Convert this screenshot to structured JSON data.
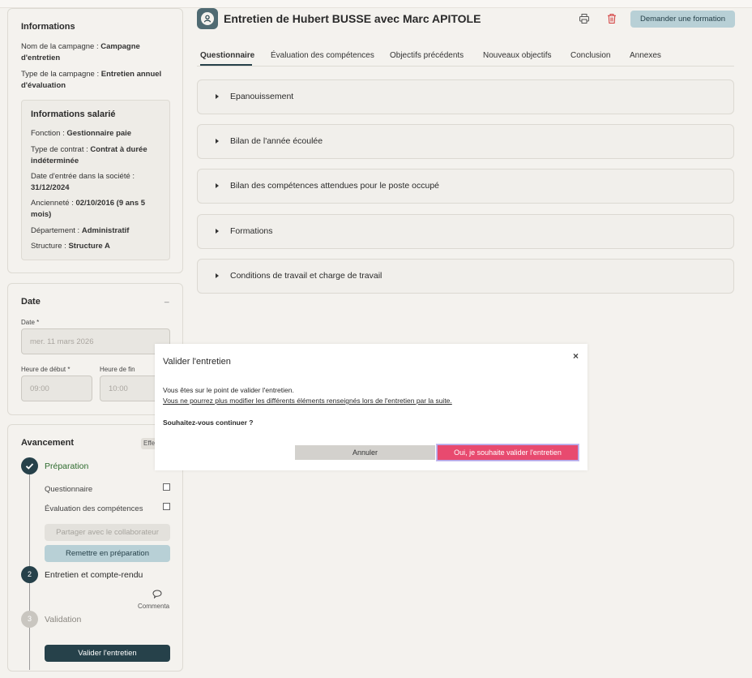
{
  "info_card": {
    "title": "Informations",
    "campaign_name_label": "Nom de la campagne : ",
    "campaign_name_value_1": "Campagne",
    "campaign_name_value_2": "d'entretien",
    "campaign_type_label": "Type de la campagne : ",
    "campaign_type_value_1": "Entretien annuel",
    "campaign_type_value_2": "d'évaluation",
    "employee": {
      "title": "Informations salarié",
      "function_label": "Fonction : ",
      "function_value": "Gestionnaire paie",
      "contract_label": "Type de contrat : ",
      "contract_value_1": "Contrat à durée",
      "contract_value_2": "indéterminée",
      "entry_label": "Date d'entrée dans la société :",
      "entry_value": "31/12/2024",
      "seniority_label": "Ancienneté : ",
      "seniority_value_1": "02/10/2016 (9 ans 5",
      "seniority_value_2": "mois)",
      "department_label": "Département : ",
      "department_value": "Administratif",
      "structure_label": "Structure : ",
      "structure_value": "Structure A"
    }
  },
  "date_card": {
    "title": "Date",
    "collapse": "_",
    "date_label": "Date *",
    "date_value": "mer. 11 mars 2026",
    "start_label": "Heure de début *",
    "start_value": "09:00",
    "end_label": "Heure de fin",
    "end_value": "10:00"
  },
  "progress_card": {
    "title": "Avancement",
    "badge": "Effe",
    "step1": "Préparation",
    "sub1": "Questionnaire",
    "sub2": "Évaluation des compétences",
    "share_button": "Partager avec le collaborateur",
    "reprepare_button": "Remettre en préparation",
    "step2_num": "2",
    "step2": "Entretien et compte-rendu",
    "comments": "Commenta",
    "step3_num": "3",
    "step3": "Validation",
    "validate_button": "Valider l'entretien"
  },
  "header": {
    "title": "Entretien de Hubert BUSSE avec Marc APITOLE",
    "request_training": "Demander une formation"
  },
  "tabs": [
    "Questionnaire",
    "Évaluation des compétences",
    "Objectifs précédents",
    "Nouveaux objectifs",
    "Conclusion",
    "Annexes"
  ],
  "sections": [
    "Epanouissement",
    "Bilan de l'année écoulée",
    "Bilan des compétences attendues pour le poste occupé",
    "Formations",
    "Conditions de travail et charge de travail"
  ],
  "dialog": {
    "title": "Valider l'entretien",
    "close": "×",
    "line1": "Vous êtes sur le point de valider l'entretien.",
    "line2": "Vous ne pourrez plus modifier les différents éléments renseignés lors de l'entretien par la suite.",
    "question": "Souhaitez-vous continuer ?",
    "cancel": "Annuler",
    "confirm": "Oui, je souhaite valider l'entretien"
  },
  "colors": {
    "dark_teal": "#26414a",
    "light_teal": "#b8d0d6",
    "green_text": "#2e6b2e",
    "confirm_pink": "#e84a6f",
    "delete_red": "#d23b3b"
  }
}
